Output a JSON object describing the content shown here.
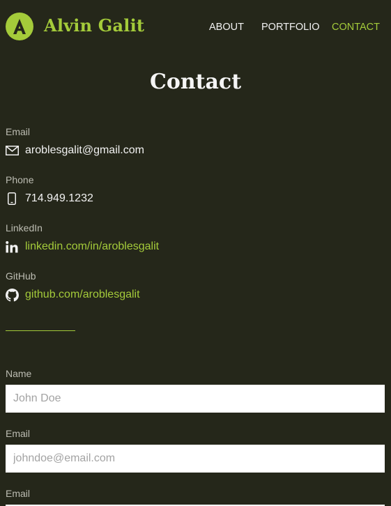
{
  "header": {
    "brand": "Alvin Galit",
    "nav": {
      "about": "ABOUT",
      "portfolio": "PORTFOLIO",
      "contact": "CONTACT"
    }
  },
  "page_title": "Contact",
  "contact": {
    "email": {
      "label": "Email",
      "value": "aroblesgalit@gmail.com"
    },
    "phone": {
      "label": "Phone",
      "value": "714.949.1232"
    },
    "linkedin": {
      "label": "LinkedIn",
      "value": "linkedin.com/in/aroblesgalit"
    },
    "github": {
      "label": "GitHub",
      "value": "github.com/aroblesgalit"
    }
  },
  "form": {
    "name": {
      "label": "Name",
      "placeholder": "John Doe"
    },
    "email": {
      "label": "Email",
      "placeholder": "johndoe@email.com"
    },
    "email2": {
      "label": "Email"
    }
  },
  "colors": {
    "background": "#25271a",
    "accent": "#a4cb3a",
    "text": "#f2f2f2"
  }
}
